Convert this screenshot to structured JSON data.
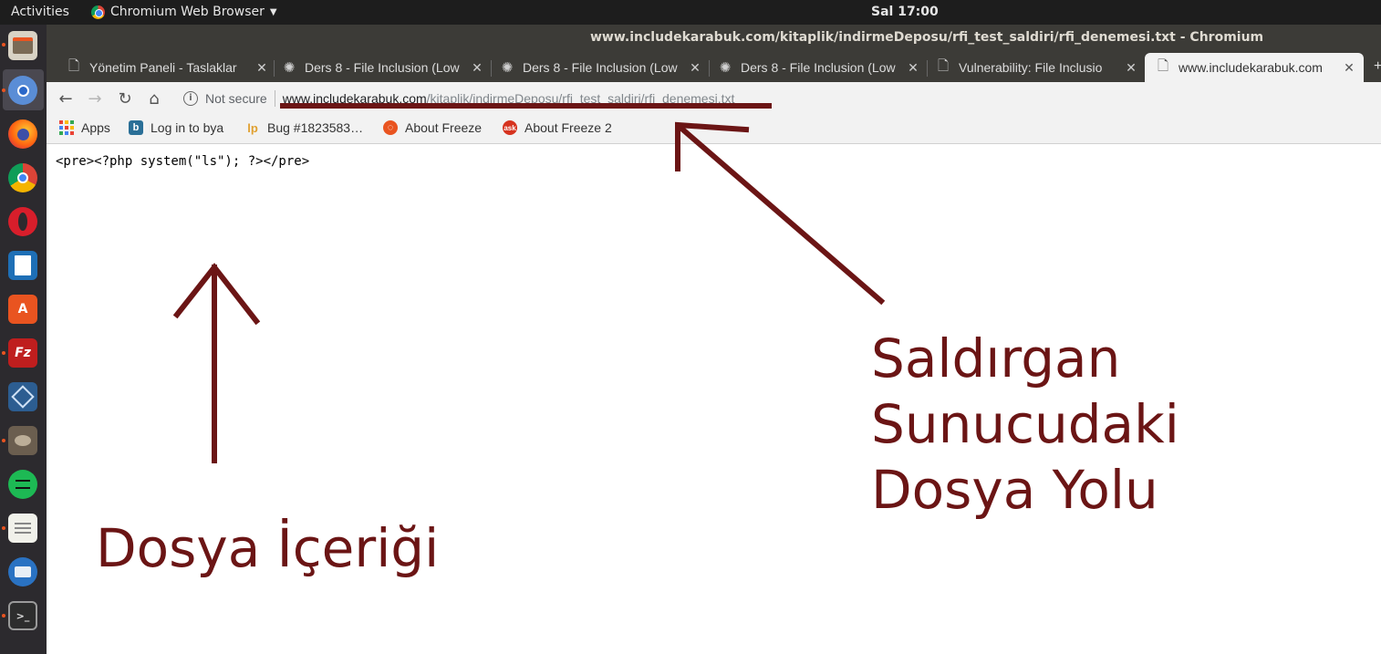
{
  "topbar": {
    "activities": "Activities",
    "app_menu": "Chromium Web Browser",
    "clock": "Sal 17:00"
  },
  "window": {
    "title": "www.includekarabuk.com/kitaplik/indirmeDeposu/rfi_test_saldiri/rfi_denemesi.txt - Chromium"
  },
  "tabs": [
    {
      "label": "Yönetim Paneli - Taslaklar",
      "icon": "page-icon"
    },
    {
      "label": "Ders 8 - File Inclusion (Low",
      "icon": "spark-icon"
    },
    {
      "label": "Ders 8 - File Inclusion (Low",
      "icon": "spark-icon"
    },
    {
      "label": "Ders 8 - File Inclusion (Low",
      "icon": "spark-icon"
    },
    {
      "label": "Vulnerability: File Inclusio",
      "icon": "page-icon"
    },
    {
      "label": "www.includekarabuk.com",
      "icon": "page-icon",
      "active": true
    }
  ],
  "omnibox": {
    "security_label": "Not secure",
    "host": "www.includekarabuk.com",
    "path": "/kitaplik/indirmeDeposu/rfi_test_saldiri/rfi_denemesi.txt"
  },
  "bookmarks": [
    {
      "label": "Apps",
      "icon": "apps-grid-icon"
    },
    {
      "label": "Log in to bya",
      "icon": "bya-icon"
    },
    {
      "label": "Bug #1823583…",
      "icon": "launchpad-icon"
    },
    {
      "label": "About Freeze",
      "icon": "ubuntu-icon"
    },
    {
      "label": "About Freeze 2",
      "icon": "askubuntu-icon"
    }
  ],
  "page": {
    "content": "<pre><?php system(\"ls\"); ?></pre>"
  },
  "annotations": {
    "content_label": "Dosya İçeriği",
    "path_label_line1": "Saldırgan",
    "path_label_line2": "Sunucudaki",
    "path_label_line3": "Dosya Yolu",
    "color": "#6b1515"
  },
  "colors": {
    "topbar": "#1d1d1d",
    "dock": "#2c2a2e",
    "tabstrip": "#3c3b37",
    "toolbar": "#f2f2f2",
    "ubuntu_orange": "#e95420"
  },
  "dock_icons": [
    "files-icon",
    "chromium-icon",
    "firefox-icon",
    "chrome-icon",
    "opera-icon",
    "libreoffice-writer-icon",
    "software-center-icon",
    "filezilla-icon",
    "virtualbox-icon",
    "gimp-icon",
    "spotify-icon",
    "text-editor-icon",
    "thunderbird-icon",
    "terminal-icon"
  ]
}
